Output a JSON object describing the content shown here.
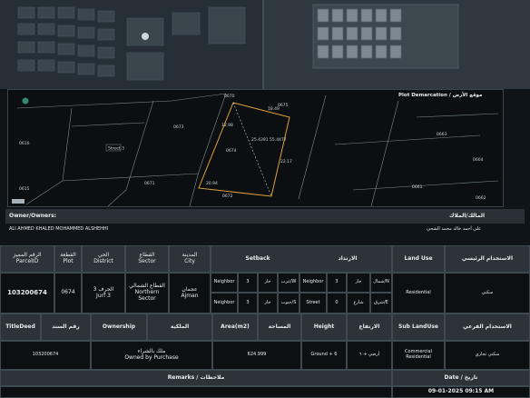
{
  "plot_section": {
    "title_en": "Plot Demarcation",
    "title_ar": "موقع الأرض",
    "parcels": [
      "0670",
      "0673",
      "0674",
      "0675",
      "0671",
      "0672",
      "0663",
      "0664",
      "0661",
      "0662",
      "0616",
      "0615"
    ],
    "street_label": "Street 3",
    "dims": [
      "18.49",
      "22.17",
      "12.98",
      "20.94"
    ],
    "coords": "25.4391  55.4477"
  },
  "owners": {
    "label_en": "Owner/Owners:",
    "label_ar": "المالك/الملاك",
    "name_en": "ALI AHMED KHALED MOHAMMED ALSHEHHI",
    "name_ar": "علي أحمد خالد محمد الشحي"
  },
  "table1": {
    "headers": {
      "parcel_en": "ParcelID",
      "parcel_ar": "الرقم المميز",
      "plot_en": "Plot",
      "plot_ar": "القطعة",
      "district_en": "District",
      "district_ar": "الحي",
      "sector_en": "Sector",
      "sector_ar": "القطاع",
      "city_en": "City",
      "city_ar": "المدينة",
      "setback_en": "Setback",
      "setback_ar": "الارتداد",
      "landuse_en": "Land Use",
      "landuse_ar": "الاستخدام الرئيسي"
    },
    "values": {
      "parcel_id": "103200674",
      "plot": "0674",
      "district_ar": "الجرف 3",
      "district_en": "Jurf 3",
      "sector_ar": "القطاع الشمالي",
      "sector_en": "Northern Sector",
      "city_ar": "عجمان",
      "city_en": "Ajman",
      "land_use_en": "Residential",
      "land_use_ar": "سكني"
    },
    "setback_rows": [
      {
        "left_type": "Neighbor",
        "left_val": "3",
        "left_ar": "جار",
        "left_dir": "غرب/W",
        "right_type": "Neighbor",
        "right_val": "3",
        "right_ar": "جار",
        "right_dir": "شمال/N"
      },
      {
        "left_type": "Neighbor",
        "left_val": "3",
        "left_ar": "جار",
        "left_dir": "جنوب/S",
        "right_type": "Street",
        "right_val": "0",
        "right_ar": "شارع",
        "right_dir": "شرق/E"
      }
    ]
  },
  "table2": {
    "headers": {
      "titledeed_en": "TitleDeed",
      "titledeed_ar": "رقم السند",
      "ownership_en": "Ownership",
      "ownership_ar": "الملكية",
      "area_en": "Area(m2)",
      "area_ar": "المساحة",
      "height_en": "Height",
      "height_ar": "الارتفاع",
      "subland_en": "Sub LandUse",
      "subland_ar": "الاستخدام الفرعي"
    },
    "values": {
      "title_deed": "103200674",
      "ownership_ar": "ملك بالشراء",
      "ownership_en": "Owned by Purchase",
      "area": "624.999",
      "height_en": "Ground + 6",
      "height_ar": "أرضي + ٦",
      "subland_en": "Commercial Residential",
      "subland_ar": "سكني تجاري"
    }
  },
  "remarks": {
    "label_en": "Remarks /",
    "label_ar": "ملاحظات"
  },
  "date": {
    "label_en": "Date /",
    "label_ar": "تاريخ",
    "value": "09-01-2025 09:15 AM"
  }
}
